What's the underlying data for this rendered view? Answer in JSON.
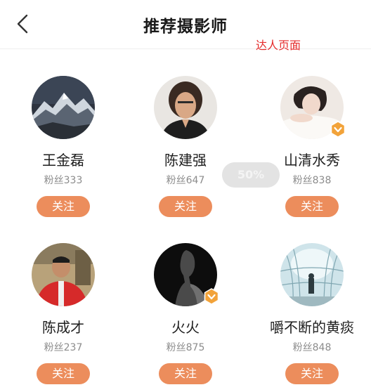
{
  "header": {
    "title": "推荐摄影师",
    "annotation": "达人页面"
  },
  "loading_toast": "50%",
  "photographers": [
    {
      "name": "王金磊",
      "fans": "粉丝333",
      "follow_label": "关注",
      "verified": false,
      "avatar": "snowy-mountain-avatar"
    },
    {
      "name": "陈建强",
      "fans": "粉丝647",
      "follow_label": "关注",
      "verified": false,
      "avatar": "man-portrait-avatar"
    },
    {
      "name": "山清水秀",
      "fans": "粉丝838",
      "follow_label": "关注",
      "verified": true,
      "avatar": "woman-portrait-avatar"
    },
    {
      "name": "陈成才",
      "fans": "粉丝237",
      "follow_label": "关注",
      "verified": false,
      "avatar": "man-red-jacket-avatar"
    },
    {
      "name": "火火",
      "fans": "粉丝875",
      "follow_label": "关注",
      "verified": true,
      "avatar": "dark-silhouette-avatar"
    },
    {
      "name": "嚼不断的黄痰",
      "fans": "粉丝848",
      "follow_label": "关注",
      "verified": false,
      "avatar": "architecture-atrium-avatar"
    }
  ],
  "colors": {
    "follow_button": "#ec8d5c",
    "verified_badge": "#f2a33a",
    "annotation": "#e52b2b"
  }
}
